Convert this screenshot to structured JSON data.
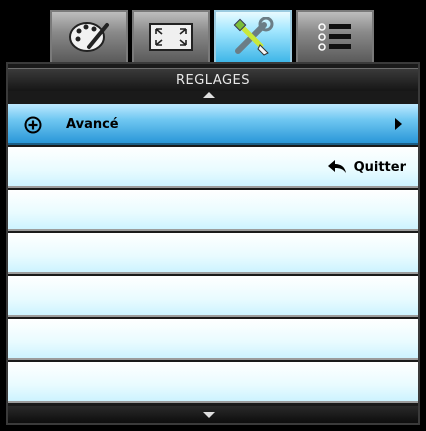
{
  "tabs": [
    {
      "icon": "palette-icon",
      "active": false
    },
    {
      "icon": "screen-expand-icon",
      "active": false
    },
    {
      "icon": "tools-icon",
      "active": true
    },
    {
      "icon": "list-icon",
      "active": false
    }
  ],
  "header": {
    "title": "REGLAGES"
  },
  "menu": {
    "items": [
      {
        "label": "Avancé",
        "icon": "plus-circle-icon",
        "selected": true,
        "has_submenu": true
      },
      {
        "label": "Quitter",
        "icon": "back-arrow-icon",
        "selected": false
      }
    ]
  },
  "colors": {
    "active_tab": "#3fb6e8",
    "selected_row": "#2a97d8",
    "row_background": "#e8fbff"
  }
}
